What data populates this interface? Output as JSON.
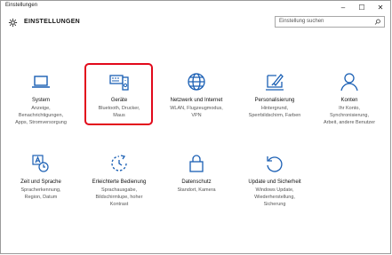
{
  "window": {
    "title": "Einstellungen",
    "minimize": "–",
    "maximize": "☐",
    "close": "✕"
  },
  "header": {
    "title": "EINSTELLUNGEN"
  },
  "search": {
    "placeholder": "Einstellung suchen"
  },
  "tiles": [
    {
      "name": "System",
      "desc": "Anzeige,\nBenachrichtigungen,\nApps, Stromversorgung",
      "icon": "laptop-icon"
    },
    {
      "name": "Geräte",
      "desc": "Bluetooth, Drucker,\nMaus",
      "icon": "devices-icon"
    },
    {
      "name": "Netzwerk und Internet",
      "desc": "WLAN, Flugzeugmodus,\nVPN",
      "icon": "globe-icon"
    },
    {
      "name": "Personalisierung",
      "desc": "Hintergrund,\nSperrbildschirm, Farben",
      "icon": "paint-icon"
    },
    {
      "name": "Konten",
      "desc": "Ihr Konto,\nSynchronisierung,\nArbeit, andere Benutzer",
      "icon": "person-icon"
    },
    {
      "name": "Zeit und Sprache",
      "desc": "Spracherkennung,\nRegion, Datum",
      "icon": "time-language-icon"
    },
    {
      "name": "Erleichterte Bedienung",
      "desc": "Sprachausgabe,\nBildschirmlupe, hoher\nKontrast",
      "icon": "ease-of-access-icon"
    },
    {
      "name": "Datenschutz",
      "desc": "Standort, Kamera",
      "icon": "lock-icon"
    },
    {
      "name": "Update und Sicherheit",
      "desc": "Windows Update,\nWiederherstellung,\nSicherung",
      "icon": "update-icon"
    }
  ],
  "colors": {
    "accent": "#1a5fb4",
    "highlight": "#e2091b"
  }
}
